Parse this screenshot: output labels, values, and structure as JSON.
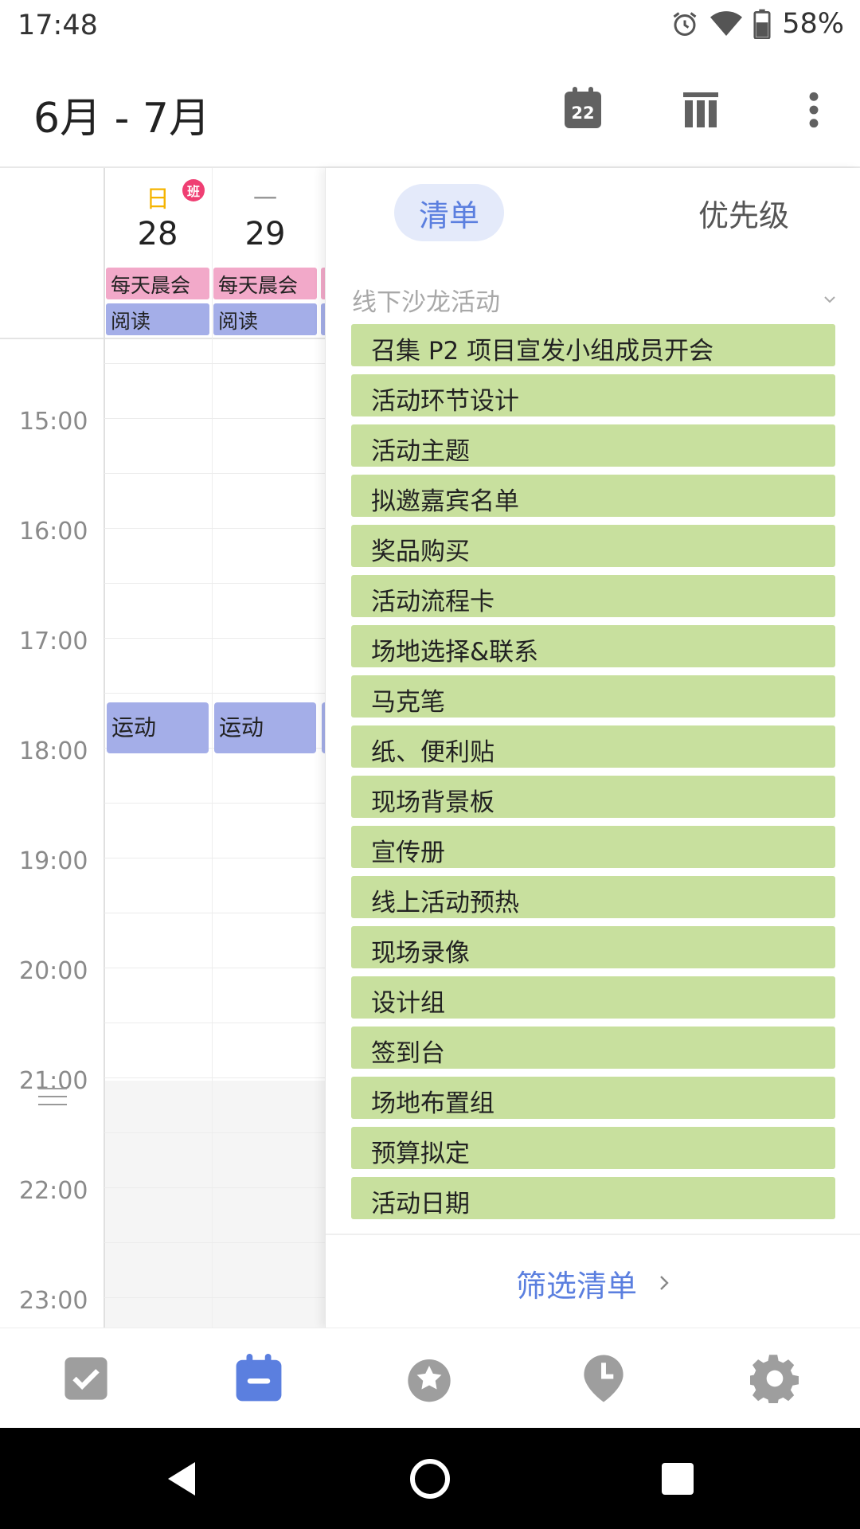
{
  "status_bar": {
    "time": "17:48",
    "battery": "58%",
    "icons": [
      "alarm-icon",
      "wifi-icon",
      "battery-icon"
    ]
  },
  "app_bar": {
    "title": "6月 - 7月",
    "today_number": "22",
    "icons": [
      "today-icon",
      "view-columns-icon",
      "more-vert-icon"
    ]
  },
  "calendar": {
    "days": [
      {
        "weekday": "日",
        "date": "28",
        "weekday_color": "#f5b400",
        "badge": "班"
      },
      {
        "weekday": "一",
        "date": "29",
        "weekday_color": "#999999"
      }
    ],
    "all_day_events": [
      {
        "title": "每天晨会",
        "color": "#f2a9c9"
      },
      {
        "title": "阅读",
        "color": "#a4aee8"
      }
    ],
    "hours": [
      "15:00",
      "16:00",
      "17:00",
      "18:00",
      "19:00",
      "20:00",
      "21:00",
      "22:00",
      "23:00"
    ],
    "timed_event": {
      "title": "运动",
      "color": "#a4aee8"
    }
  },
  "panel": {
    "tabs": [
      {
        "label": "清单",
        "active": true
      },
      {
        "label": "优先级",
        "active": false
      }
    ],
    "list_name": "线下沙龙活动",
    "tasks": [
      "召集 P2 项目宣发小组成员开会",
      "活动环节设计",
      "活动主题",
      "拟邀嘉宾名单",
      "奖品购买",
      "活动流程卡",
      "场地选择&联系",
      "马克笔",
      "纸、便利贴",
      "现场背景板",
      "宣传册",
      "线上活动预热",
      "现场录像",
      "设计组",
      "签到台",
      "场地布置组",
      "预算拟定",
      "活动日期"
    ],
    "task_color": "#c8e09e",
    "filter_label": "筛选清单"
  },
  "bottom_nav": {
    "items": [
      "tasks-tab-icon",
      "calendar-tab-icon",
      "habit-tab-icon",
      "pomodoro-tab-icon",
      "settings-tab-icon"
    ],
    "active": "calendar-tab-icon",
    "accent": "#5b7fdf"
  }
}
